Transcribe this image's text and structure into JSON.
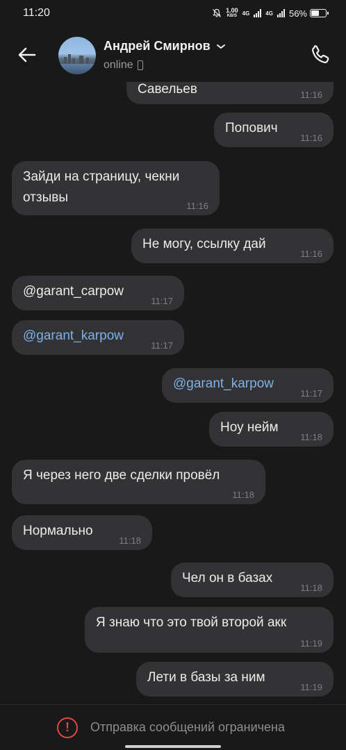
{
  "status_bar": {
    "time": "11:20",
    "net_speed_value": "1.00",
    "net_speed_unit": "KB/S",
    "network_1": "4G",
    "network_2": "4G",
    "battery_percent": "56%",
    "battery_level": 0.56
  },
  "header": {
    "contact_name": "Андрей Смирнов",
    "status": "online"
  },
  "messages": [
    {
      "side": "out",
      "text": "Савельев",
      "time": "11:16"
    },
    {
      "side": "out",
      "text": "Попович",
      "time": "11:16"
    },
    {
      "side": "in",
      "text": "Зайди на страницу, чекни отзывы",
      "time": "11:16"
    },
    {
      "side": "out",
      "text": "Не могу, ссылку дай",
      "time": "11:16"
    },
    {
      "side": "in",
      "text": "@garant_carpow",
      "time": "11:17"
    },
    {
      "side": "in",
      "text": "@garant_karpow",
      "time": "11:17",
      "link": true
    },
    {
      "side": "out",
      "text": "@garant_karpow",
      "time": "11:17",
      "link": true
    },
    {
      "side": "out",
      "text": "Ноу нейм",
      "time": "11:18"
    },
    {
      "side": "in",
      "text": "Я через него две сделки провёл",
      "time": "11:18"
    },
    {
      "side": "in",
      "text": "Нормально",
      "time": "11:18"
    },
    {
      "side": "out",
      "text": "Чел он в базах",
      "time": "11:18"
    },
    {
      "side": "out",
      "text": "Я знаю что это твой второй акк",
      "time": "11:19"
    },
    {
      "side": "out",
      "text": "Лети в базы за ним",
      "time": "11:19"
    }
  ],
  "footer": {
    "restriction_text": "Отправка сообщений ограничена",
    "icon": "exclamation-circle-icon",
    "icon_color": "#e04848"
  },
  "colors": {
    "background": "#19191a",
    "bubble": "#333335",
    "link": "#7eb0ea"
  }
}
